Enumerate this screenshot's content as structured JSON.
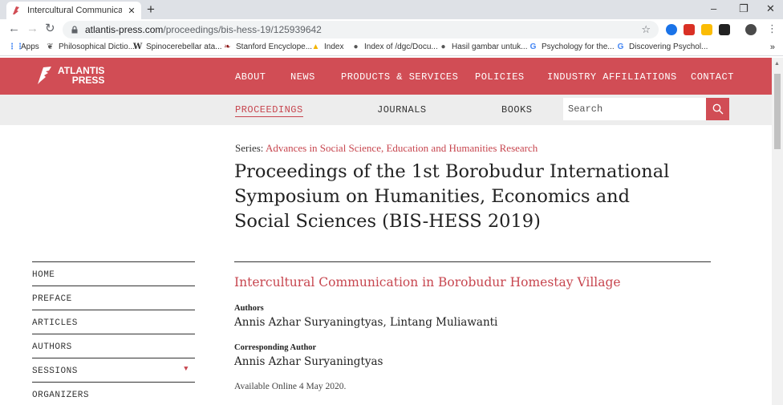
{
  "browser": {
    "tab_title": "Intercultural Communication in B",
    "tab_close": "✕",
    "new_tab": "+",
    "url_host": "atlantis-press.com",
    "url_path": "/proceedings/bis-hess-19/125939642",
    "window_controls": [
      "–",
      "❐",
      "✕"
    ]
  },
  "bookmarks": [
    {
      "label": "Apps",
      "icon": "apps-grid-icon",
      "color": "#4285f4"
    },
    {
      "label": "Philosophical Dictio...",
      "icon": "philosophy-icon",
      "color": "#555"
    },
    {
      "label": "Spinocerebellar ata...",
      "icon": "wikipedia-icon",
      "color": "#000"
    },
    {
      "label": "Stanford Encyclope...",
      "icon": "stanford-icon",
      "color": "#8c1515"
    },
    {
      "label": "Index",
      "icon": "drive-icon",
      "color": "#f4b400"
    },
    {
      "label": "Index of /dgc/Docu...",
      "icon": "globe-icon",
      "color": "#555"
    },
    {
      "label": "Hasil gambar untuk...",
      "icon": "globe-icon",
      "color": "#555"
    },
    {
      "label": "Psychology for the...",
      "icon": "google-icon",
      "color": "#4285f4"
    },
    {
      "label": "Discovering Psychol...",
      "icon": "google-icon",
      "color": "#4285f4"
    }
  ],
  "bookmarks_more": "»",
  "site": {
    "logo_line1": "ATLANTIS",
    "logo_line2": "PRESS",
    "main_nav": [
      "ABOUT",
      "NEWS",
      "PRODUCTS & SERVICES",
      "POLICIES",
      "INDUSTRY AFFILIATIONS",
      "CONTACT"
    ],
    "sub_nav": [
      "PROCEEDINGS",
      "JOURNALS",
      "BOOKS"
    ],
    "search_placeholder": "Search",
    "accent_color": "#d14d55"
  },
  "sidebar": {
    "items": [
      "HOME",
      "PREFACE",
      "ARTICLES",
      "AUTHORS",
      "SESSIONS",
      "ORGANIZERS"
    ]
  },
  "content": {
    "series_label": "Series:",
    "series_name": "Advances in Social Science, Education and Humanities Research",
    "proceedings_title": "Proceedings of the 1st Borobudur International Symposium on Humanities, Economics and Social Sciences (BIS-HESS 2019)",
    "article_title": "Intercultural Communication in Borobudur Homestay Village",
    "authors_label": "Authors",
    "authors": "Annis Azhar Suryaningtyas, Lintang Muliawanti",
    "corresponding_label": "Corresponding Author",
    "corresponding_author": "Annis Azhar Suryaningtyas",
    "available": "Available Online 4 May 2020."
  }
}
